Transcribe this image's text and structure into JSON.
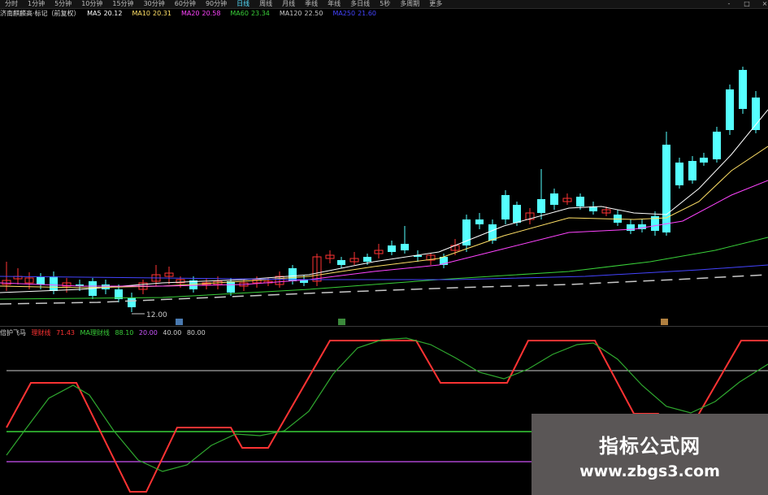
{
  "toolbar": {
    "periods": [
      "分时",
      "1分钟",
      "5分钟",
      "10分钟",
      "15分钟",
      "30分钟",
      "60分钟",
      "90分钟",
      "日线",
      "周线",
      "月线",
      "季线",
      "年线",
      "多日线",
      "5秒",
      "多周期",
      "更多"
    ],
    "active_period": "日线",
    "buttons": [
      "-",
      "□",
      "×"
    ]
  },
  "main_chart": {
    "name": "济南麒麟高·标记（前复权）",
    "ma": [
      {
        "label": "MA5",
        "value": "20.12",
        "color": "#ffffff"
      },
      {
        "label": "MA10",
        "value": "20.31",
        "color": "#ffe066"
      },
      {
        "label": "MA20",
        "value": "20.58",
        "color": "#ff44ff"
      },
      {
        "label": "MA60",
        "value": "23.34",
        "color": "#39d039"
      },
      {
        "label": "MA120",
        "value": "22.50",
        "color": "#c8c8c8"
      },
      {
        "label": "MA250",
        "value": "21.60",
        "color": "#4444ff"
      }
    ],
    "low_marker": "12.00"
  },
  "indicator": {
    "name": "倍护飞马",
    "line1": {
      "label": "理财线",
      "value": "71.43",
      "color": "#ff3333"
    },
    "line2": {
      "label": "MA理财线",
      "value": "88.10",
      "color": "#39d039"
    },
    "levels": [
      "20.00",
      "40.00",
      "80.00"
    ]
  },
  "watermark": {
    "title": "指标公式网",
    "url": "www.zbgs3.com"
  },
  "colors": {
    "up": "#ff3333",
    "down": "#55ffff"
  }
}
